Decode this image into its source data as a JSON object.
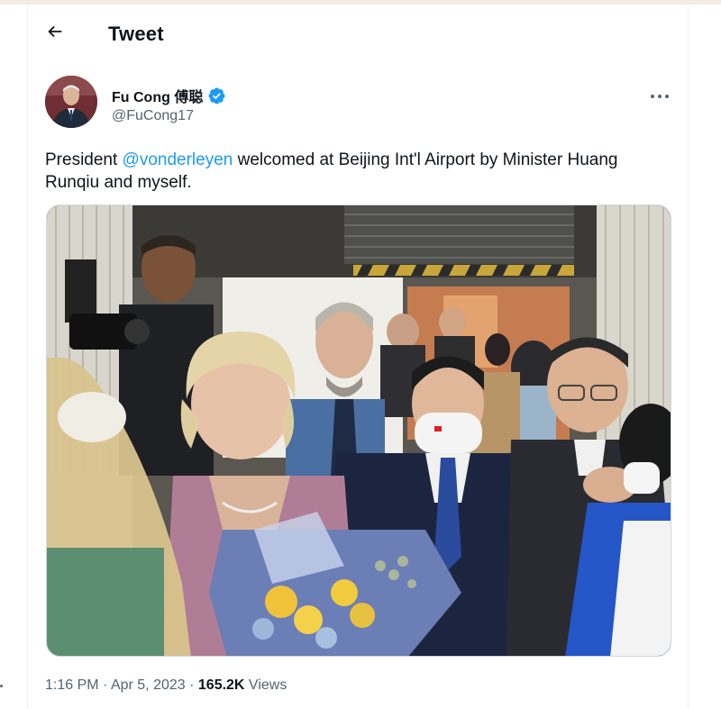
{
  "header": {
    "title": "Tweet",
    "back_icon": "arrow-left-icon"
  },
  "author": {
    "display_name": "Fu Cong 傅聪",
    "handle": "@FuCong17",
    "verified_icon": "verified-badge-icon",
    "verified_color": "#1d9bf0",
    "more_icon": "more-horizontal-icon"
  },
  "tweet": {
    "text_before": "President ",
    "mention": "@vonderleyen",
    "text_after": " welcomed at Beijing Int'l Airport by Minister Huang Runqiu and myself."
  },
  "meta": {
    "time": "1:16 PM",
    "sep1": " · ",
    "date": "Apr 5, 2023",
    "sep2": " · ",
    "views_count": "165.2K",
    "views_label": " Views"
  },
  "colors": {
    "link": "#1d9bf0",
    "secondary_text": "#536471",
    "border": "#cfd9de"
  }
}
